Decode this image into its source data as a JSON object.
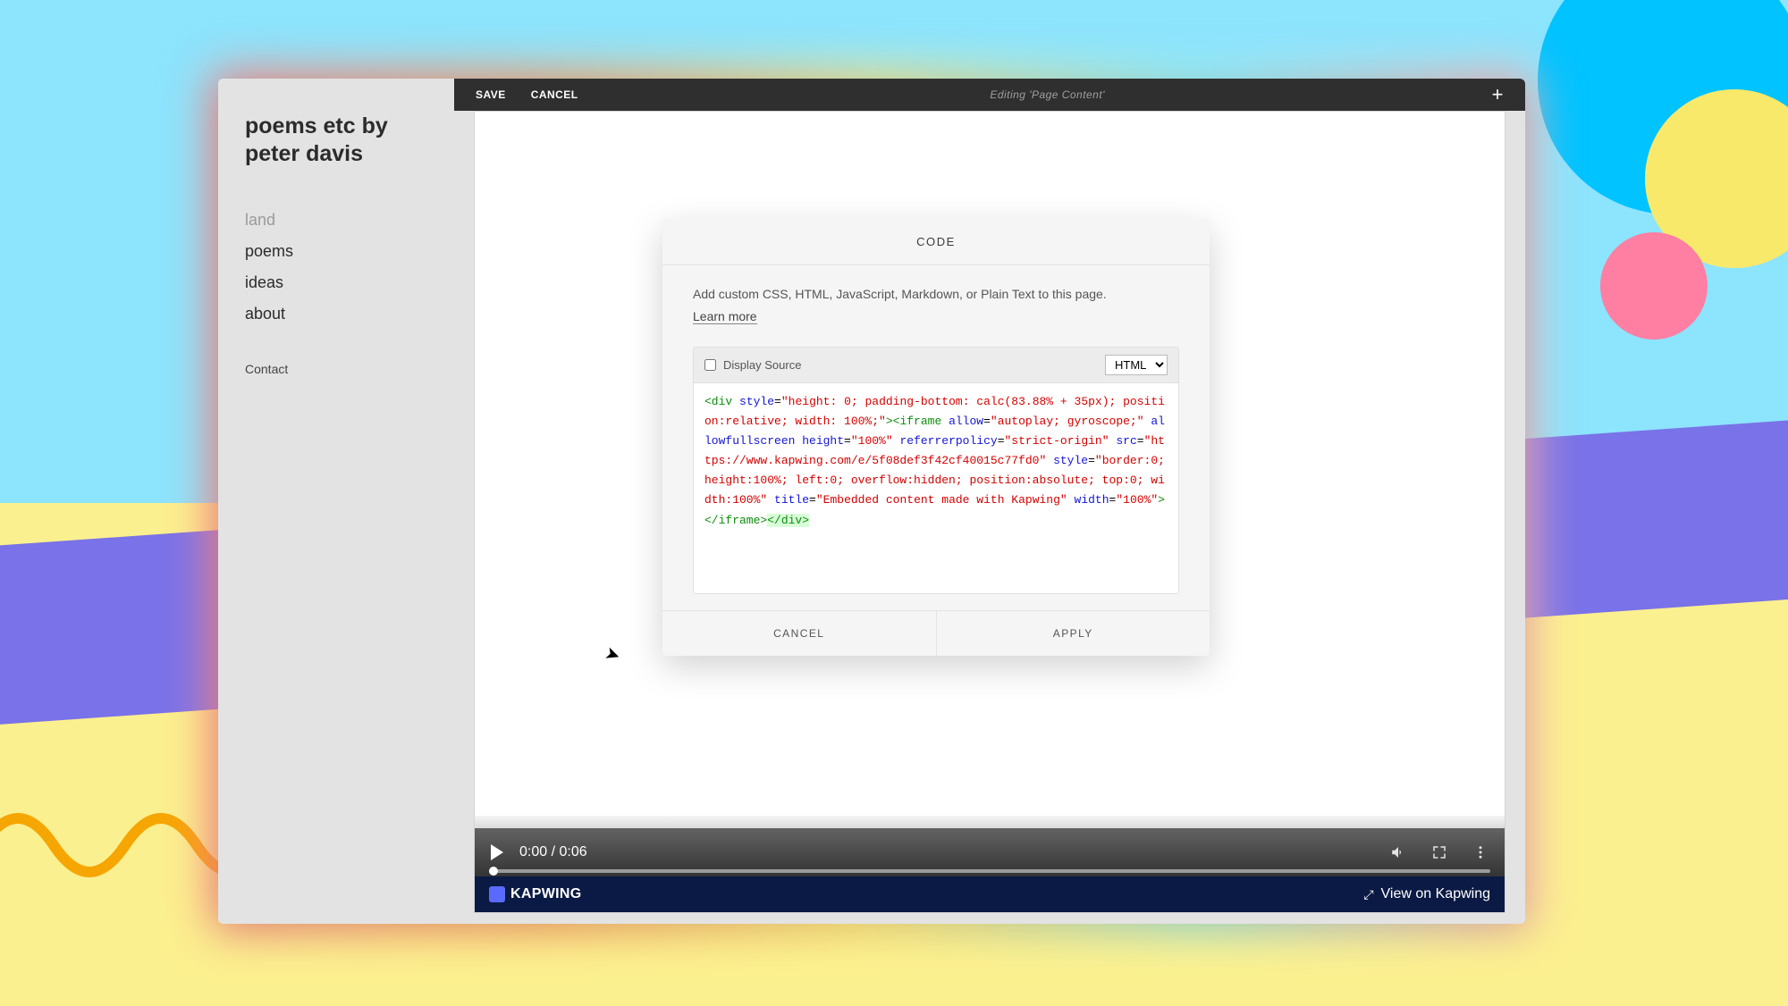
{
  "sidebar": {
    "title": "poems etc by peter davis",
    "nav": [
      {
        "label": "land",
        "active": true
      },
      {
        "label": "poems",
        "active": false
      },
      {
        "label": "ideas",
        "active": false
      },
      {
        "label": "about",
        "active": false
      }
    ],
    "contact": "Contact"
  },
  "topbar": {
    "save": "SAVE",
    "cancel": "CANCEL",
    "status": "Editing 'Page Content'",
    "plus": "+"
  },
  "video": {
    "time": "0:00 / 0:06"
  },
  "kapwing": {
    "brand": "KAPWING",
    "view": "View on Kapwing"
  },
  "modal": {
    "title": "CODE",
    "description": "Add custom CSS, HTML, JavaScript, Markdown, or Plain Text to this page.",
    "learn_more": "Learn more",
    "display_source": "Display Source",
    "format": "HTML",
    "cancel": "CANCEL",
    "apply": "APPLY",
    "code": {
      "t1": "<div",
      "a1": "style",
      "s1": "\"height: 0; padding-bottom: calc(83.88% + 35px); position:relative; width: 100%;\"",
      "t2": "><iframe",
      "a2": "allow",
      "s2": "\"autoplay; gyroscope;\"",
      "a3": "allowfullscreen height",
      "s3": "\"100%\"",
      "a4": "referrerpolicy",
      "s4": "\"strict-origin\"",
      "a5": "src",
      "s5": "\"https://www.kapwing.com/e/5f08def3f42cf40015c77fd0\"",
      "a6": "style",
      "s6": "\"border:0; height:100%; left:0; overflow:hidden; position:absolute; top:0; width:100%\"",
      "a7": "title",
      "s7": "\"Embedded content made with Kapwing\"",
      "a8": "width",
      "s8": "\"100%\"",
      "t3": "></iframe>",
      "t4": "</div>"
    }
  }
}
